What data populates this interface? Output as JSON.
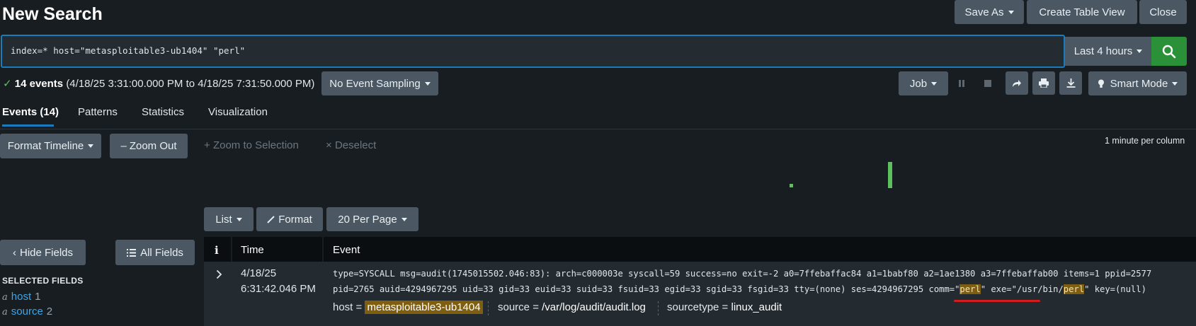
{
  "header": {
    "title": "New Search",
    "save_as": "Save As",
    "create_table_view": "Create Table View",
    "close": "Close"
  },
  "search": {
    "query": "index=* host=\"metasploitable3-ub1404\" \"perl\"",
    "time_range": "Last 4 hours"
  },
  "status": {
    "count": "14 events",
    "range": "(4/18/25 3:31:00.000 PM to 4/18/25 7:31:50.000 PM)",
    "sampling": "No Event Sampling",
    "job": "Job",
    "mode": "Smart Mode"
  },
  "tabs": [
    "Events (14)",
    "Patterns",
    "Statistics",
    "Visualization"
  ],
  "timeline": {
    "format_timeline": "Format Timeline",
    "zoom_out": "Zoom Out",
    "zoom_to_selection": "Zoom to Selection",
    "deselect": "Deselect",
    "scale_label": "1 minute per column"
  },
  "results_toolbar": {
    "list": "List",
    "format": "Format",
    "per_page": "20 Per Page"
  },
  "sidebar": {
    "hide_fields": "Hide Fields",
    "all_fields": "All Fields",
    "selected_fields_heading": "SELECTED FIELDS",
    "fields": [
      {
        "type": "a",
        "name": "host",
        "count": "1"
      },
      {
        "type": "a",
        "name": "source",
        "count": "2"
      }
    ]
  },
  "table": {
    "col_info": "i",
    "col_time": "Time",
    "col_event": "Event",
    "row": {
      "date": "4/18/25",
      "time": "6:31:42.046 PM",
      "line1": "type=SYSCALL msg=audit(1745015502.046:83): arch=c000003e syscall=59 success=no exit=-2 a0=7ffebaffac84 a1=1babf80 a2=1ae1380 a3=7ffebaffab00 items=1 ppid=2577",
      "line2_a": "pid=2765 auid=4294967295 uid=33 gid=33 euid=33 suid=33 fsuid=33 egid=33 sgid=33 fsgid=33 tty=(none) ses=4294967295 comm=\"",
      "line2_hl1": "perl",
      "line2_b": "\" exe=\"/usr/bin/",
      "line2_hl2": "perl",
      "line2_c": "\" key=(null)",
      "host_label": "host =",
      "host_value": "metasploitable3-ub1404",
      "source_label": "source =",
      "source_value": "/var/log/audit/audit.log",
      "sourcetype_label": "sourcetype =",
      "sourcetype_value": "linux_audit"
    }
  }
}
